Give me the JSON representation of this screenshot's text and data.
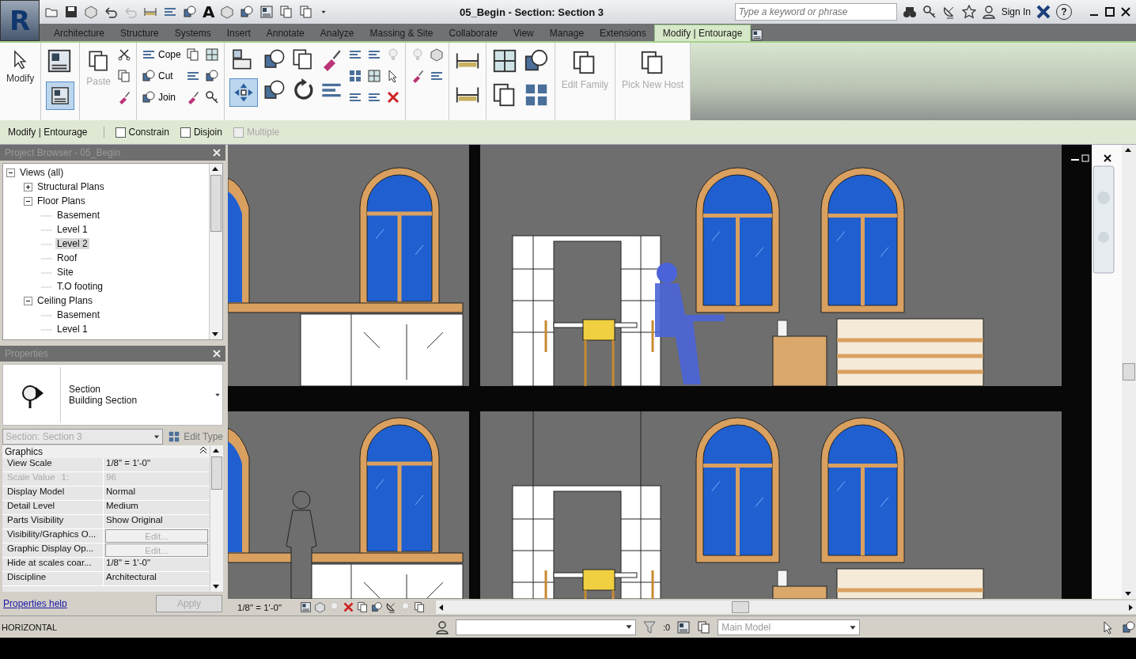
{
  "app": {
    "logo": "R",
    "text_tool": "A",
    "title": "05_Begin - Section: Section 3",
    "search": {
      "placeholder": "Type a keyword or phrase"
    },
    "sign_in": "Sign In",
    "help": "?"
  },
  "tabs": [
    {
      "label": "Architecture",
      "selected": false
    },
    {
      "label": "Structure",
      "selected": false
    },
    {
      "label": "Systems",
      "selected": false
    },
    {
      "label": "Insert",
      "selected": false
    },
    {
      "label": "Annotate",
      "selected": false
    },
    {
      "label": "Analyze",
      "selected": false
    },
    {
      "label": "Massing & Site",
      "selected": false
    },
    {
      "label": "Collaborate",
      "selected": false
    },
    {
      "label": "View",
      "selected": false
    },
    {
      "label": "Manage",
      "selected": false
    },
    {
      "label": "Extensions",
      "selected": false
    },
    {
      "label": "Modify | Entourage",
      "selected": true
    }
  ],
  "ribbon": {
    "modify": {
      "label": "Modify",
      "disabled": false
    },
    "paste": {
      "label": "Paste",
      "disabled": true
    },
    "geometry": [
      {
        "label": "Cope"
      },
      {
        "label": "Cut"
      },
      {
        "label": "Join"
      }
    ],
    "host": [
      {
        "label": "Edit Family",
        "disabled": true
      },
      {
        "label": "Pick New Host",
        "disabled": true
      }
    ]
  },
  "options_bar": {
    "context": "Modify | Entourage",
    "options": [
      {
        "label": "Constrain",
        "checked": false,
        "disabled": false
      },
      {
        "label": "Disjoin",
        "checked": false,
        "disabled": false
      },
      {
        "label": "Multiple",
        "checked": false,
        "disabled": true
      }
    ]
  },
  "project_browser": {
    "title": "Project Browser - 05_Begin",
    "tree": [
      {
        "label": "Views (all)",
        "expanded": true,
        "selected": false,
        "children": [
          {
            "label": "Structural Plans",
            "expanded": false,
            "selected": false
          },
          {
            "label": "Floor Plans",
            "expanded": true,
            "selected": false,
            "children": [
              {
                "label": "Basement",
                "selected": false
              },
              {
                "label": "Level 1",
                "selected": false
              },
              {
                "label": "Level 2",
                "selected": true
              },
              {
                "label": "Roof",
                "selected": false
              },
              {
                "label": "Site",
                "selected": false
              },
              {
                "label": "T.O footing",
                "selected": false
              }
            ]
          },
          {
            "label": "Ceiling Plans",
            "expanded": true,
            "selected": false,
            "children": [
              {
                "label": "Basement",
                "selected": false
              },
              {
                "label": "Level 1",
                "selected": false
              }
            ]
          }
        ]
      }
    ]
  },
  "properties": {
    "title": "Properties",
    "type_name": "Section",
    "type_family": "Building Section",
    "instance": "Section: Section 3",
    "edit_type": "Edit Type",
    "group": "Graphics",
    "rows": [
      {
        "name": "View Scale",
        "value": "1/8\" = 1'-0\"",
        "kind": "text",
        "disabled": false
      },
      {
        "name": "Scale Value",
        "suffix": "1:",
        "value": "96",
        "kind": "text",
        "disabled": true
      },
      {
        "name": "Display Model",
        "value": "Normal",
        "kind": "text",
        "disabled": false
      },
      {
        "name": "Detail Level",
        "value": "Medium",
        "kind": "text",
        "disabled": false
      },
      {
        "name": "Parts Visibility",
        "value": "Show Original",
        "kind": "text",
        "disabled": false
      },
      {
        "name": "Visibility/Graphics O...",
        "value": "Edit...",
        "kind": "button",
        "disabled": false
      },
      {
        "name": "Graphic Display Op...",
        "value": "Edit...",
        "kind": "button",
        "disabled": false
      },
      {
        "name": "Hide at scales coar...",
        "value": "1/8\" = 1'-0\"",
        "kind": "text",
        "disabled": false
      },
      {
        "name": "Discipline",
        "value": "Architectural",
        "kind": "text",
        "disabled": false
      }
    ],
    "help": "Properties help",
    "apply": {
      "label": "Apply",
      "disabled": true
    }
  },
  "view": {
    "scale": "1/8\" = 1'-0\""
  },
  "status_bar": {
    "message": "HORIZONTAL",
    "filter_count": ":0",
    "workset": "Main Model"
  }
}
